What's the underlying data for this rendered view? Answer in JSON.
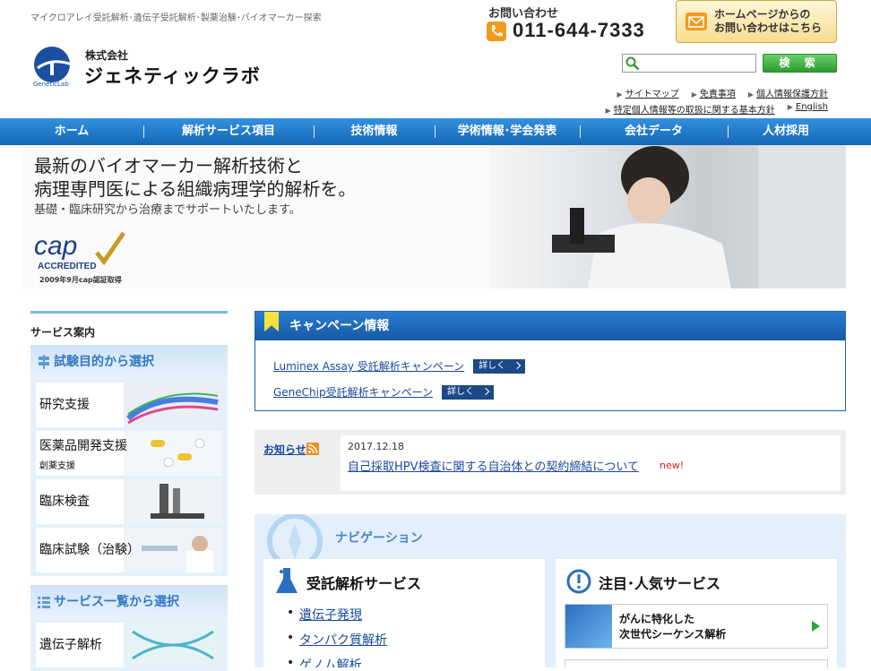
{
  "header": {
    "tagline": "マイクロアレイ受託解析･遺伝子受託解析･製薬治験･バイオマーカー探索",
    "logo_text": "GeneticLab",
    "company_prefix": "株式会社",
    "company_name": "ジェネティックラボ",
    "contact_label": "お問い合わせ",
    "phone": "011-644-7333",
    "contact_button_line1": "ホームページからの",
    "contact_button_line2": "お問い合わせはこちら",
    "search_placeholder": "",
    "search_button": "検 索",
    "util_links_row1": [
      "サイトマップ",
      "免責事項",
      "個人情報保護方針"
    ],
    "util_links_row2": [
      "特定個人情報等の取扱に関する基本方針",
      "English"
    ]
  },
  "global_nav": [
    {
      "label": "ホーム"
    },
    {
      "label": "解析サービス項目"
    },
    {
      "label": "技術情報"
    },
    {
      "label": "学術情報･学会発表"
    },
    {
      "label": "会社データ"
    },
    {
      "label": "人材採用"
    }
  ],
  "hero": {
    "headline_line1": "最新のバイオマーカー解析技術と",
    "headline_line2": "病理専門医による組織病理学的解析を。",
    "subline": "基礎・臨床研究から治療までサポートいたします。",
    "cap_logo_text": "cap",
    "cap_accredited": "ACCREDITED",
    "cap_note": "2009年9月cap認証取得"
  },
  "sidebar": {
    "title": "サービス案内",
    "section1_title": "試験目的から選択",
    "categories": [
      {
        "label": "研究支援",
        "sub": ""
      },
      {
        "label": "医薬品開発支援",
        "sub": "創薬支援"
      },
      {
        "label": "臨床検査",
        "sub": ""
      },
      {
        "label": "臨床試験（治験）",
        "sub": ""
      }
    ],
    "section2_title": "サービス一覧から選択",
    "services": [
      {
        "label": "遺伝子解析"
      }
    ]
  },
  "campaign": {
    "title": "キャンペーン情報",
    "items": [
      {
        "label": "Luminex Assay 受託解析キャンペーン",
        "button": "詳しく"
      },
      {
        "label": "GeneChip受託解析キャンペーン",
        "button": "詳しく"
      }
    ]
  },
  "news": {
    "label": "お知らせ",
    "date": "2017.12.18",
    "title": "自己採取HPV検査に関する自治体との契約締結について",
    "badge": "new!"
  },
  "navigation": {
    "title": "ナビゲーション",
    "col1_title": "受託解析サービス",
    "col1_items": [
      "遺伝子発現",
      "タンパク質解析",
      "ゲノム解析"
    ],
    "col2_title": "注目･人気サービス",
    "banner_line1": "がんに特化した",
    "banner_line2": "次世代シーケンス解析"
  },
  "colors": {
    "nav_blue": "#1e74c8",
    "link_blue": "#1a4a9a",
    "search_green": "#3aa83a",
    "phone_orange": "#f29a1c",
    "new_red": "#e01d1d"
  }
}
